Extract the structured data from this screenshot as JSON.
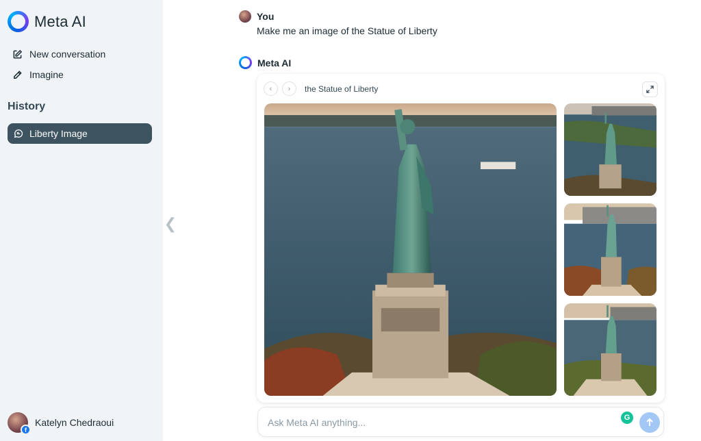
{
  "app": {
    "brand_name": "Meta AI"
  },
  "sidebar": {
    "nav_items": [
      {
        "label": "New conversation",
        "icon": "edit-icon"
      },
      {
        "label": "Imagine",
        "icon": "pencil-icon"
      }
    ],
    "history_title": "History",
    "history_items": [
      {
        "label": "Liberty Image",
        "icon": "chat-bubble-icon",
        "selected": true
      }
    ],
    "user": {
      "name": "Katelyn Chedraoui",
      "badge": "f"
    }
  },
  "conversation": {
    "user_message": {
      "author": "You",
      "text": "Make me an image of the Statue of Liberty"
    },
    "ai_message": {
      "author": "Meta AI"
    },
    "image_card": {
      "title": "the Statue of Liberty",
      "prev_icon": "‹",
      "next_icon": "›",
      "image_count": 4
    }
  },
  "composer": {
    "placeholder": "Ask Meta AI anything...",
    "value": "",
    "grammarly_label": "G"
  },
  "colors": {
    "accent": "#0064e0",
    "history_selected_bg": "#3e5360",
    "sidebar_bg": "#f1f4f7",
    "send_button": "#a4c8f5"
  }
}
